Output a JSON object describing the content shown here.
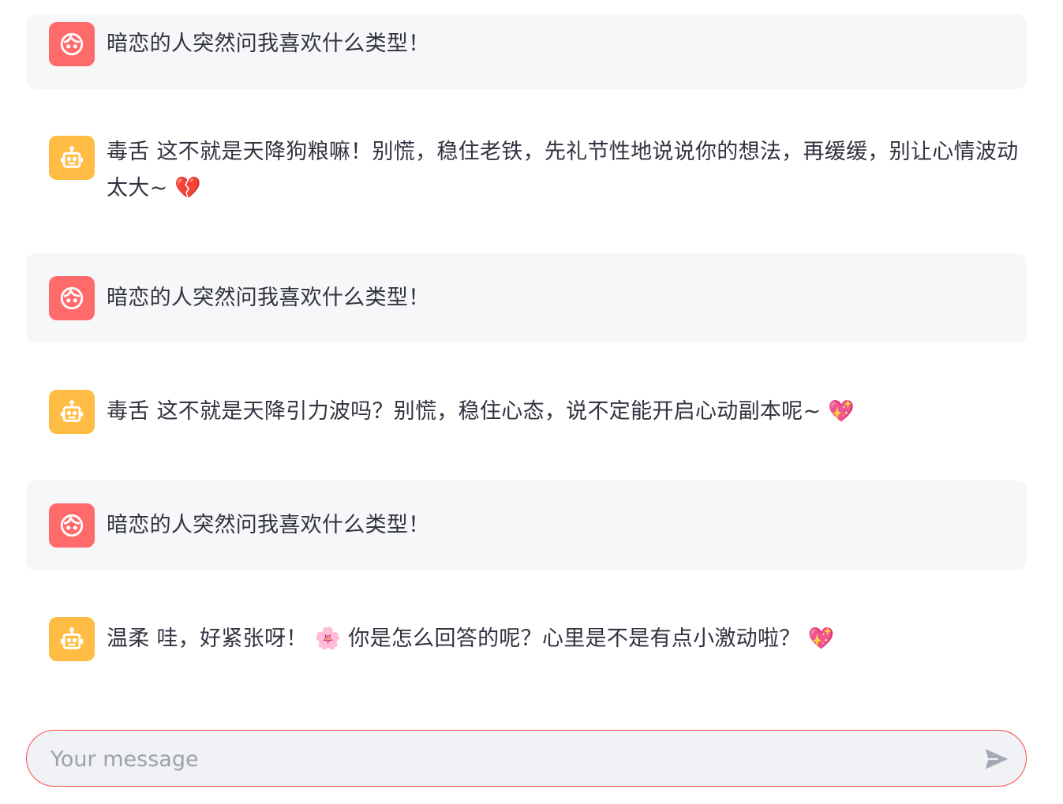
{
  "messages": [
    {
      "role": "user",
      "avatar_icon": "smiley-face-icon",
      "text": "暗恋的人突然问我喜欢什么类型！"
    },
    {
      "role": "assistant",
      "avatar_icon": "robot-icon",
      "text": "毒舌 这不就是天降狗粮嘛！别慌，稳住老铁，先礼节性地说说你的想法，再缓缓，别让心情波动太大~ 💔"
    },
    {
      "role": "user",
      "avatar_icon": "smiley-face-icon",
      "text": "暗恋的人突然问我喜欢什么类型！"
    },
    {
      "role": "assistant",
      "avatar_icon": "robot-icon",
      "text": "毒舌 这不就是天降引力波吗？别慌，稳住心态，说不定能开启心动副本呢~ 💖"
    },
    {
      "role": "user",
      "avatar_icon": "smiley-face-icon",
      "text": "暗恋的人突然问我喜欢什么类型！"
    },
    {
      "role": "assistant",
      "avatar_icon": "robot-icon",
      "text": "温柔 哇，好紧张呀！ 🌸 你是怎么回答的呢？心里是不是有点小激动啦？ 💖"
    }
  ],
  "input": {
    "placeholder": "Your message",
    "value": ""
  },
  "colors": {
    "user_avatar": "#ff6b6b",
    "assistant_avatar": "#ffbd45",
    "user_bubble": "#f6f7f9",
    "input_border": "#ff4b4b",
    "input_bg": "#f0f2f6"
  }
}
